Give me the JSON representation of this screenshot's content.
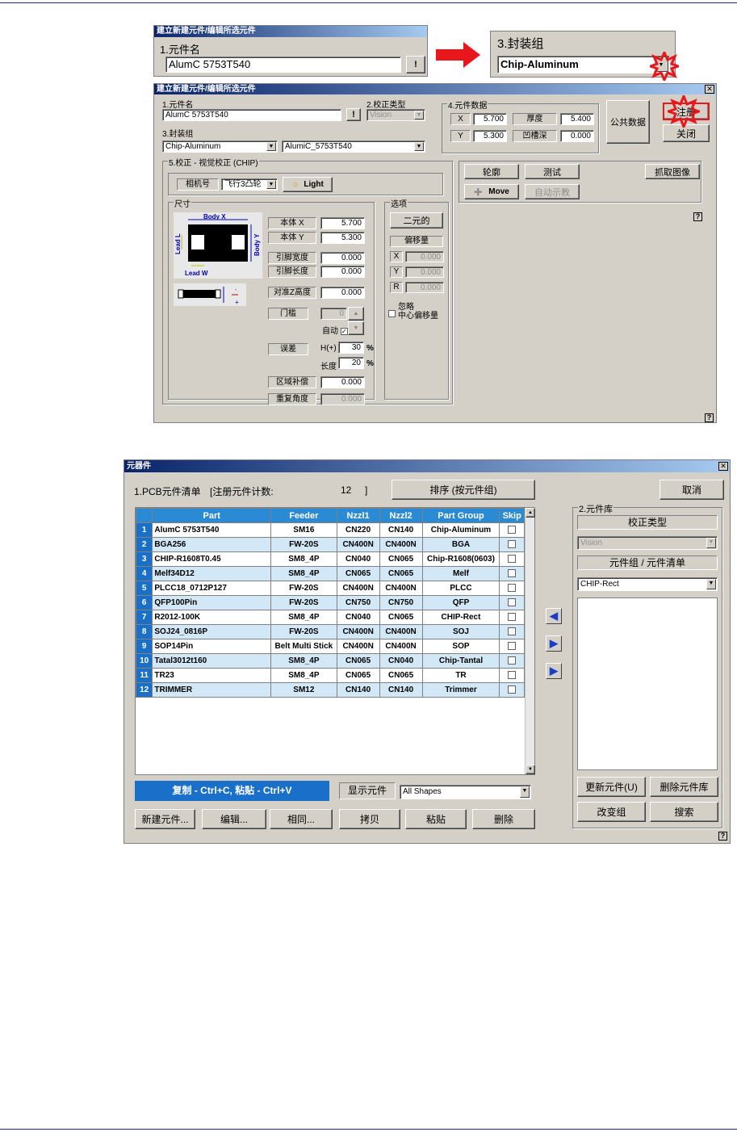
{
  "top_snip1": {
    "title": "建立新建元件/编辑所选元件",
    "label": "1.元件名",
    "value": "AlumC 5753T540",
    "btn": "!"
  },
  "top_snip2": {
    "label": "3.封装组",
    "value": "Chip-Aluminum"
  },
  "dlg1": {
    "title": "建立新建元件/编辑所选元件",
    "name_label": "1.元件名",
    "name_value": "AlumC 5753T540",
    "name_btn": "!",
    "cal_label": "2.校正类型",
    "cal_value": "Vision",
    "pkg_label": "3.封装组",
    "pkg_value": "Chip-Aluminum",
    "pkg_sub": "AlumiC_5753T540",
    "data_label": "4.元件数据",
    "x_label": "X",
    "x_value": "5.700",
    "y_label": "Y",
    "y_value": "5.300",
    "thick_label": "厚度",
    "thick_value": "5.400",
    "groove_label": "凹槽深",
    "groove_value": "0.000",
    "common_btn": "公共数据",
    "register_btn": "注册",
    "close_btn": "关闭",
    "sec5_label": "5.校正 - 视觉校正 (CHIP)",
    "camera_label": "相机号",
    "camera_value": "飞行3凸轮",
    "light_btn": "Light",
    "outline_btn": "轮廓",
    "test_btn": "测试",
    "grab_btn": "抓取图像",
    "move_btn": "Move",
    "teach_btn": "自动示教",
    "size_label": "尺寸",
    "diagram": {
      "body_x": "Body X",
      "body_y": "Body Y",
      "lead_l": "Lead L",
      "lead_w": "Lead W"
    },
    "body_x_label": "本体 X",
    "body_x_value": "5.700",
    "body_y_label": "本体 Y",
    "body_y_value": "5.300",
    "lead_w_label": "引脚宽度",
    "lead_w_value": "0.000",
    "lead_l_label": "引脚长度",
    "lead_l_value": "0.000",
    "align_label": "对准Z高度",
    "align_value": "0.000",
    "thresh_label": "门槛",
    "thresh_value": "0",
    "auto_label": "自动",
    "err_label": "误差",
    "err_w_label": "H(+)",
    "err_w_value": "30",
    "err_l_label": "长度",
    "err_l_value": "20",
    "pct": "%",
    "comp_label": "区域补偿",
    "comp_value": "0.000",
    "rep_label": "重复角度",
    "rep_value": "0.000",
    "opt_label": "选项",
    "binary_btn": "二元的",
    "offset_label": "偏移量",
    "off_x_label": "X",
    "off_x_value": "0.000",
    "off_y_label": "Y",
    "off_y_value": "0.000",
    "off_r_label": "R",
    "off_r_value": "0.000",
    "ignore_label1": "忽略",
    "ignore_label2": "中心偏移量",
    "qm": "?"
  },
  "dlg2": {
    "title": "元器件",
    "list_label": "1.PCB元件清单",
    "count_label": "[注册元件计数:",
    "count_value": "12",
    "count_end": "]",
    "sort_btn": "排序 (按元件组)",
    "cancel_btn": "取消",
    "headers": [
      "Part",
      "Feeder",
      "Nzzl1",
      "Nzzl2",
      "Part Group",
      "Skip"
    ],
    "rows": [
      [
        "1",
        "AlumC 5753T540",
        "SM16",
        "CN220",
        "CN140",
        "Chip-Aluminum"
      ],
      [
        "2",
        "BGA256",
        "FW-20S",
        "CN400N",
        "CN400N",
        "BGA"
      ],
      [
        "3",
        "CHIP-R1608T0.45",
        "SM8_4P",
        "CN040",
        "CN065",
        "Chip-R1608(0603)"
      ],
      [
        "4",
        "Melf34D12",
        "SM8_4P",
        "CN065",
        "CN065",
        "Melf"
      ],
      [
        "5",
        "PLCC18_0712P127",
        "FW-20S",
        "CN400N",
        "CN400N",
        "PLCC"
      ],
      [
        "6",
        "QFP100Pin",
        "FW-20S",
        "CN750",
        "CN750",
        "QFP"
      ],
      [
        "7",
        "R2012-100K",
        "SM8_4P",
        "CN040",
        "CN065",
        "CHIP-Rect"
      ],
      [
        "8",
        "SOJ24_0816P",
        "FW-20S",
        "CN400N",
        "CN400N",
        "SOJ"
      ],
      [
        "9",
        "SOP14Pin",
        "Belt Multi Stick",
        "CN400N",
        "CN400N",
        "SOP"
      ],
      [
        "10",
        "Tatal3012t160",
        "SM8_4P",
        "CN065",
        "CN040",
        "Chip-Tantal"
      ],
      [
        "11",
        "TR23",
        "SM8_4P",
        "CN065",
        "CN065",
        "TR"
      ],
      [
        "12",
        "TRIMMER",
        "SM12",
        "CN140",
        "CN140",
        "Trimmer"
      ]
    ],
    "copy_paste": "复制 - Ctrl+C, 粘贴 - Ctrl+V",
    "show_label": "显示元件",
    "show_value": "All Shapes",
    "new_btn": "新建元件...",
    "edit_btn": "编辑...",
    "same_btn": "相同...",
    "copy_btn": "拷贝",
    "paste_btn": "粘贴",
    "delete_btn": "删除",
    "lib_label": "2.元件库",
    "lib_cal": "校正类型",
    "lib_cal_value": "Vision",
    "lib_group": "元件组 / 元件清单",
    "lib_group_value": "CHIP-Rect",
    "update_btn": "更新元件(U)",
    "del_lib_btn": "删除元件库",
    "change_btn": "改变组",
    "search_btn": "搜索",
    "qm": "?"
  },
  "colors": {
    "title_bar": "#0a246a",
    "grid_header": "#2a8ad4",
    "row_alt": "#d2e8f6",
    "red_arrow": "#e8171b",
    "copy_bar": "#1a6fc8"
  }
}
